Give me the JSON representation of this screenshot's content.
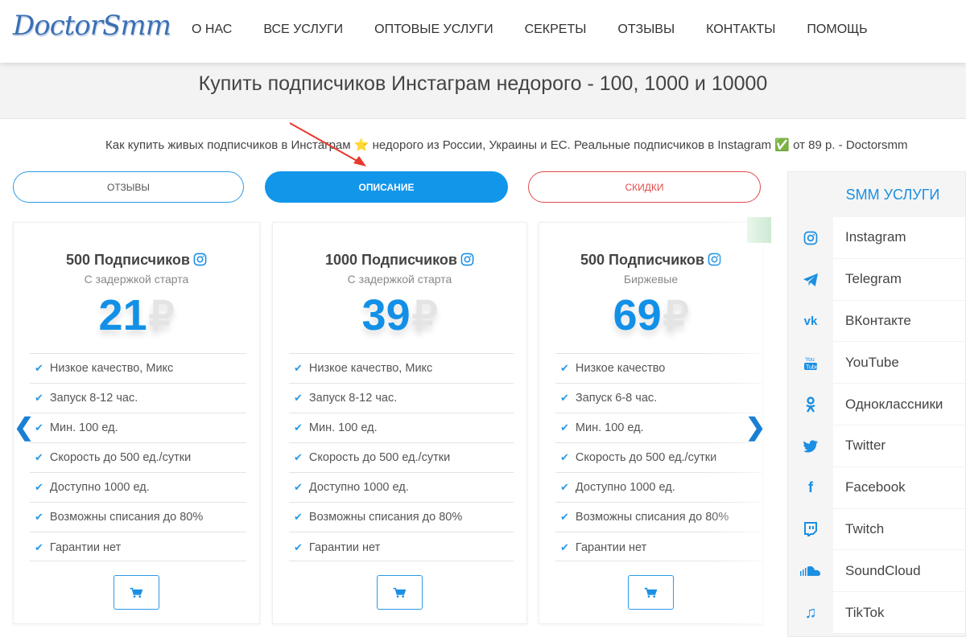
{
  "header": {
    "logo": "DoctorSmm",
    "nav": [
      "О НАС",
      "ВСЕ УСЛУГИ",
      "ОПТОВЫЕ УСЛУГИ",
      "СЕКРЕТЫ",
      "ОТЗЫВЫ",
      "КОНТАКТЫ",
      "ПОМОЩЬ"
    ]
  },
  "page_title": "Купить подписчиков Инстаграм недорого - 100, 1000 и 10000",
  "subtitle": {
    "part1": "Как купить живых подписчиков в Инстаграм ",
    "star": "⭐",
    "part2": " недорого из России, Украины и ЕС. Реальные подписчиков в Instagram ",
    "check": "✅",
    "part3": " от 89 р. - Doctorsmm"
  },
  "tabs": {
    "reviews": "ОТЗЫВЫ",
    "description": "ОПИСАНИЕ",
    "discounts": "СКИДКИ"
  },
  "cards": [
    {
      "title": "500 Подписчиков",
      "subtitle": "С задержкой старта",
      "price": "21",
      "currency": "₽",
      "features": [
        "Низкое качество, Микс",
        "Запуск 8-12 час.",
        "Мин. 100 ед.",
        "Скорость до 500 ед./сутки",
        "Доступно 1000 ед.",
        "Возможны списания до 80%",
        "Гарантии нет"
      ]
    },
    {
      "title": "1000 Подписчиков",
      "subtitle": "С задержкой старта",
      "price": "39",
      "currency": "₽",
      "features": [
        "Низкое качество, Микс",
        "Запуск 8-12 час.",
        "Мин. 100 ед.",
        "Скорость до 500 ед./сутки",
        "Доступно 1000 ед.",
        "Возможны списания до 80%",
        "Гарантии нет"
      ]
    },
    {
      "title": "500 Подписчиков",
      "subtitle": "Биржевые",
      "price": "69",
      "currency": "₽",
      "features": [
        "Низкое качество",
        "Запуск 6-8 час.",
        "Мин. 100 ед.",
        "Скорость до 500 ед./сутки",
        "Доступно 1000 ед.",
        "Возможны списания до 80%",
        "Гарантии нет"
      ]
    }
  ],
  "carousel": {
    "prev": "❮",
    "next": "❯"
  },
  "sidebar": {
    "title": "SMM УСЛУГИ",
    "items": [
      {
        "label": "Instagram",
        "icon": "instagram-icon"
      },
      {
        "label": "Telegram",
        "icon": "telegram-icon"
      },
      {
        "label": "ВКонтакте",
        "icon": "vk-icon"
      },
      {
        "label": "YouTube",
        "icon": "youtube-icon"
      },
      {
        "label": "Одноклассники",
        "icon": "odnoklassniki-icon"
      },
      {
        "label": "Twitter",
        "icon": "twitter-icon"
      },
      {
        "label": "Facebook",
        "icon": "facebook-icon"
      },
      {
        "label": "Twitch",
        "icon": "twitch-icon"
      },
      {
        "label": "SoundCloud",
        "icon": "soundcloud-icon"
      },
      {
        "label": "TikTok",
        "icon": "tiktok-icon"
      }
    ]
  },
  "colors": {
    "accent": "#1296ea",
    "danger": "#e24a4a",
    "annotation_arrow": "#e8392c"
  }
}
